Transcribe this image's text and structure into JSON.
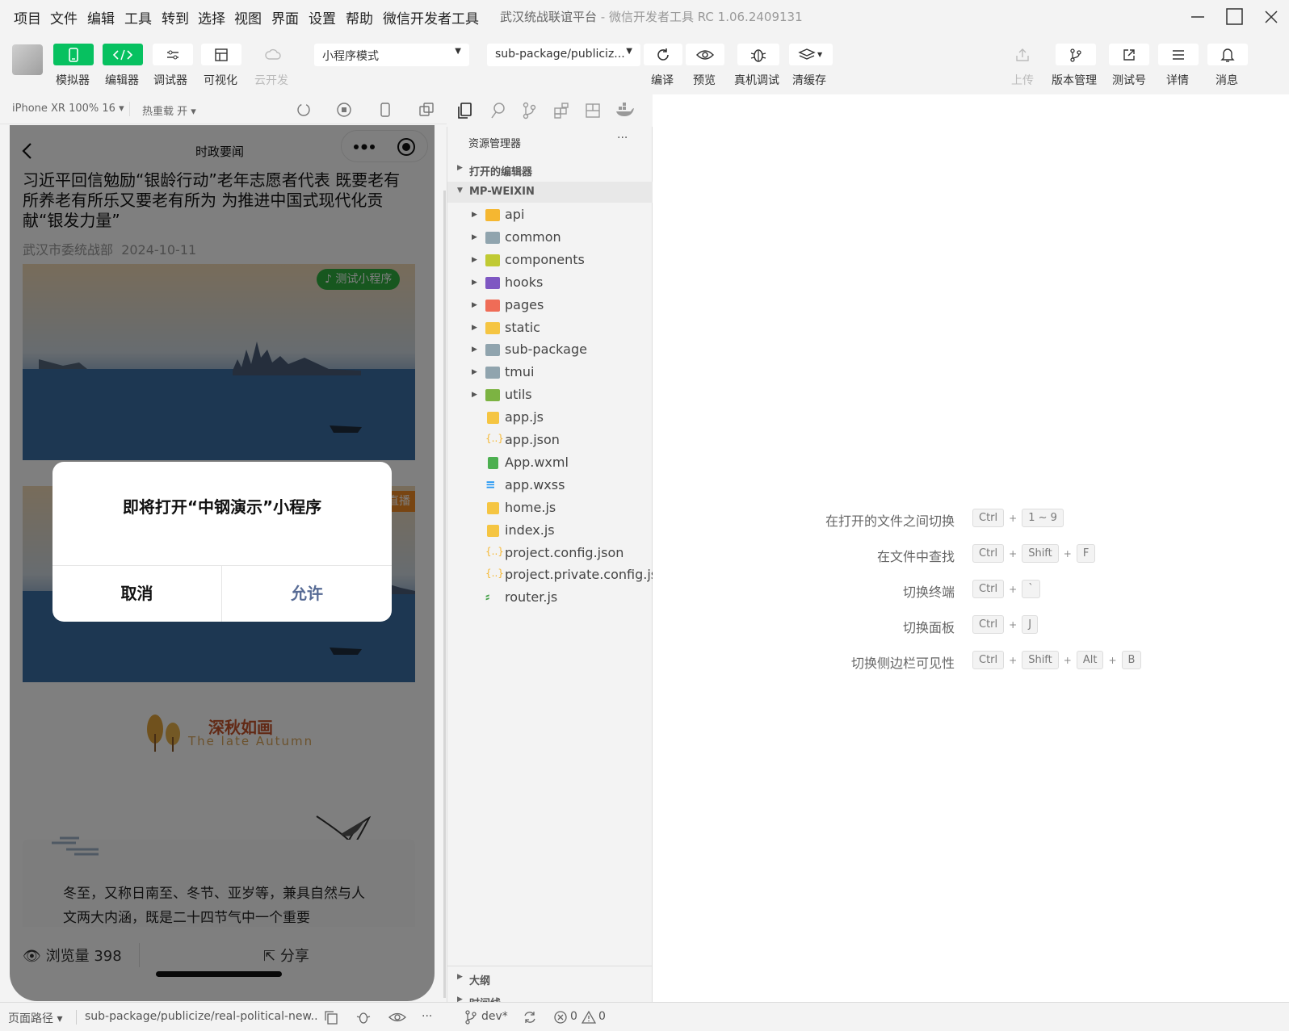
{
  "menubar": {
    "items": [
      "项目",
      "文件",
      "编辑",
      "工具",
      "转到",
      "选择",
      "视图",
      "界面",
      "设置",
      "帮助",
      "微信开发者工具"
    ],
    "title": "武汉统战联谊平台",
    "title_sep": " - ",
    "title_sub": "微信开发者工具 RC 1.06.2409131"
  },
  "toolbar": {
    "simulator": "模拟器",
    "editor": "编辑器",
    "debugger": "调试器",
    "visual": "可视化",
    "cloud": "云开发",
    "mode": "小程序模式",
    "page": "sub-package/publiciz...",
    "compile": "编译",
    "preview": "预览",
    "remote_debug": "真机调试",
    "clear_cache": "清缓存",
    "upload": "上传",
    "version": "版本管理",
    "test_account": "测试号",
    "details": "详情",
    "messages": "消息"
  },
  "simbar": {
    "device": "iPhone XR 100% 16",
    "hotreload": "热重载 开"
  },
  "phone": {
    "nav_title": "时政要闻",
    "article_title": "习近平回信勉励“银龄行动”老年志愿者代表 既要老有所养老有所乐又要老有所为 为推进中国式现代化贡献“银发力量”",
    "source": "武汉市委统战部",
    "date": "2024-10-11",
    "badge": "测试小程序",
    "badge2": "直播",
    "autumn_cn": "深秋如画",
    "autumn_en": "The late Autumn",
    "body_text": "冬至，又称日南至、冬节、亚岁等，兼具自然与人文两大内涵，既是二十四节气中一个重要",
    "views": "浏览量 398",
    "share": "分享",
    "dialog_title": "即将打开“中钢演示”小程序",
    "cancel": "取消",
    "allow": "允许"
  },
  "explorer": {
    "header": "资源管理器",
    "more": "···",
    "open_editors": "打开的编辑器",
    "root": "MP-WEIXIN",
    "items": [
      {
        "name": "api",
        "kind": "folder",
        "color": "#f5b731"
      },
      {
        "name": "common",
        "kind": "folder",
        "color": "#90a4ae"
      },
      {
        "name": "components",
        "kind": "folder",
        "color": "#c0ca33"
      },
      {
        "name": "hooks",
        "kind": "folder",
        "color": "#7e57c2"
      },
      {
        "name": "pages",
        "kind": "folder",
        "color": "#ef6c57"
      },
      {
        "name": "static",
        "kind": "folder",
        "color": "#f5c542"
      },
      {
        "name": "sub-package",
        "kind": "folder",
        "color": "#90a4ae"
      },
      {
        "name": "tmui",
        "kind": "folder",
        "color": "#90a4ae"
      },
      {
        "name": "utils",
        "kind": "folder",
        "color": "#7cb342"
      },
      {
        "name": "app.js",
        "kind": "js",
        "color": "#f5c542"
      },
      {
        "name": "app.json",
        "kind": "json",
        "color": "#f5b731"
      },
      {
        "name": "App.wxml",
        "kind": "wxml",
        "color": "#4caf50"
      },
      {
        "name": "app.wxss",
        "kind": "wxss",
        "color": "#2196f3"
      },
      {
        "name": "home.js",
        "kind": "js",
        "color": "#f5c542"
      },
      {
        "name": "index.js",
        "kind": "js",
        "color": "#f5c542"
      },
      {
        "name": "project.config.json",
        "kind": "json",
        "color": "#f5b731"
      },
      {
        "name": "project.private.config.js...",
        "kind": "json",
        "color": "#f5b731"
      },
      {
        "name": "router.js",
        "kind": "router",
        "color": "#43a047"
      }
    ],
    "outline": "大纲",
    "timeline": "时间线"
  },
  "shortcuts": [
    {
      "label": "在打开的文件之间切换",
      "keys": [
        "Ctrl",
        "1 ~ 9"
      ]
    },
    {
      "label": "在文件中查找",
      "keys": [
        "Ctrl",
        "Shift",
        "F"
      ]
    },
    {
      "label": "切换终端",
      "keys": [
        "Ctrl",
        "`"
      ]
    },
    {
      "label": "切换面板",
      "keys": [
        "Ctrl",
        "J"
      ]
    },
    {
      "label": "切换侧边栏可见性",
      "keys": [
        "Ctrl",
        "Shift",
        "Alt",
        "B"
      ]
    }
  ],
  "statusbar": {
    "page_path_label": "页面路径",
    "page_path": "sub-package/publicize/real-political-new...",
    "branch": "dev*",
    "errors": "0",
    "warnings": "0"
  }
}
